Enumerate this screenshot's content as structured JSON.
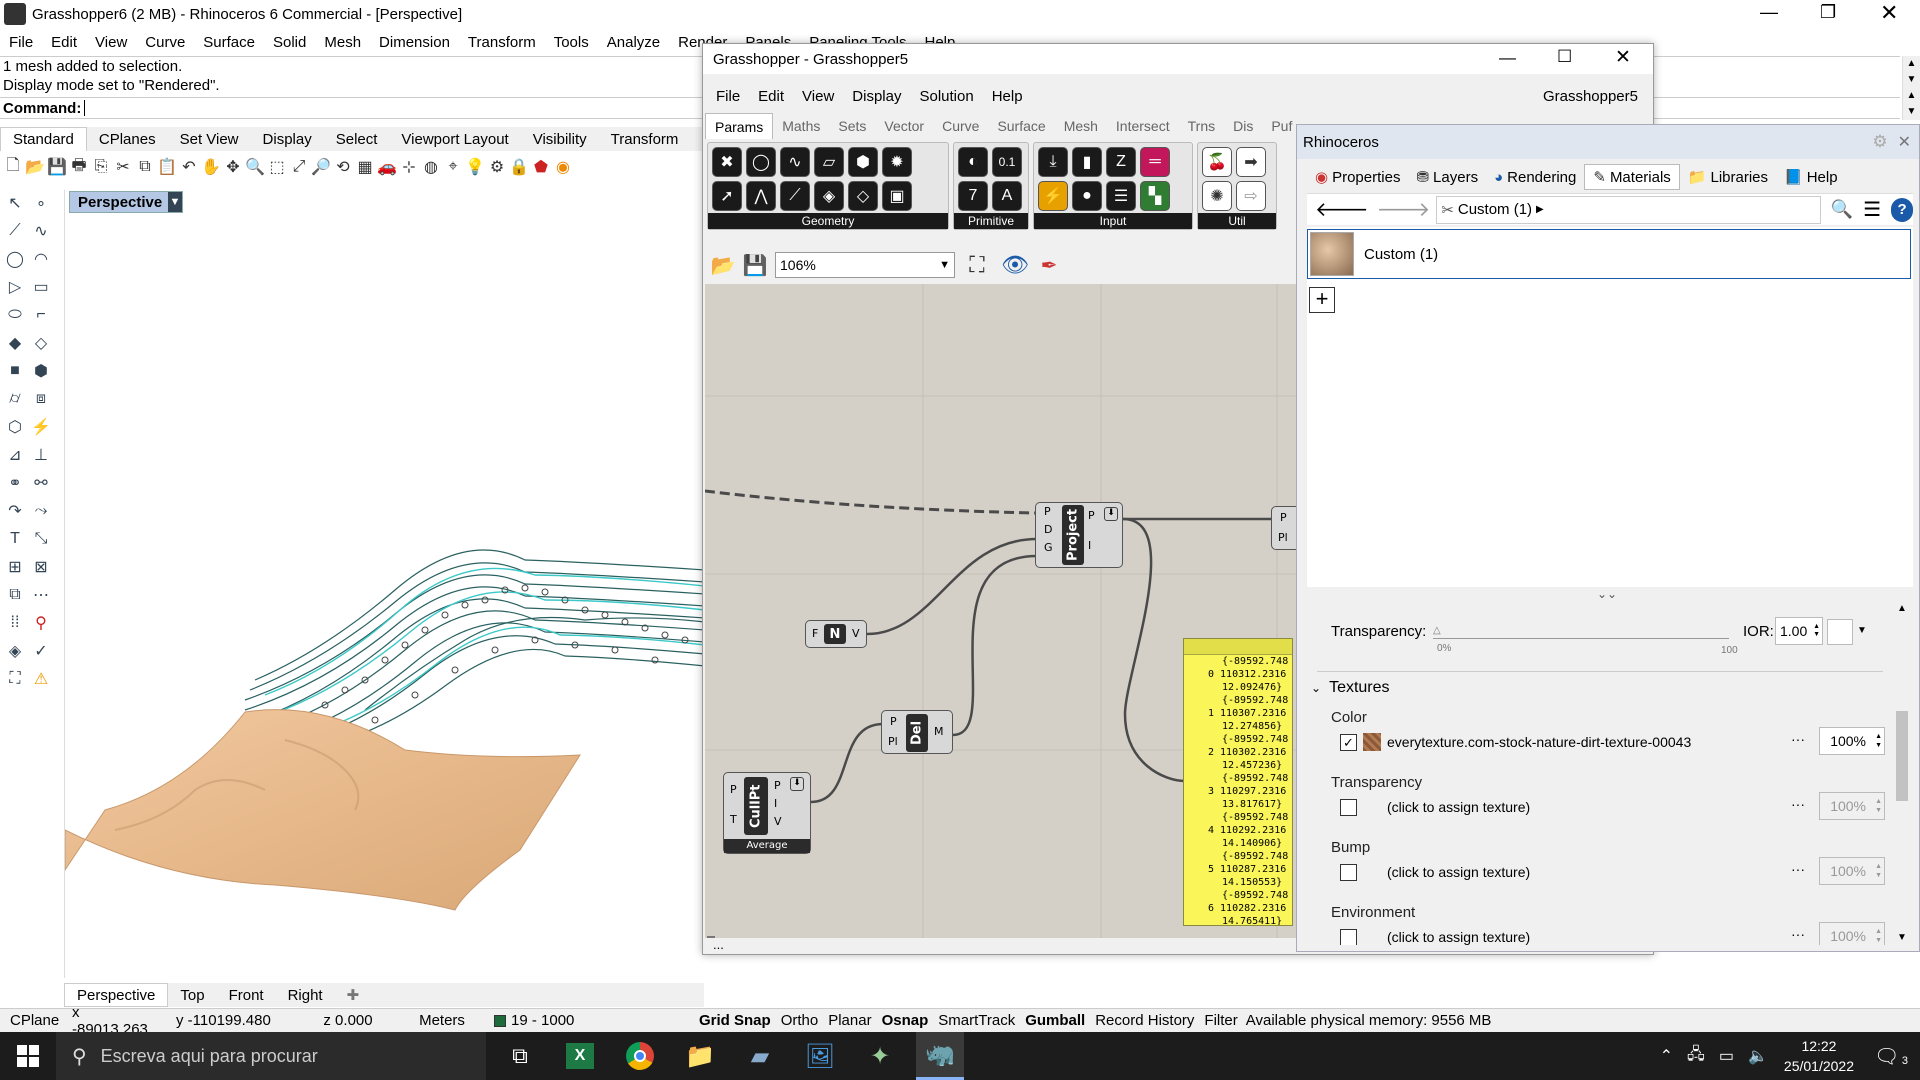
{
  "rhino": {
    "title": "Grasshopper6 (2 MB) - Rhinoceros 6 Commercial - [Perspective]",
    "menu": [
      "File",
      "Edit",
      "View",
      "Curve",
      "Surface",
      "Solid",
      "Mesh",
      "Dimension",
      "Transform",
      "Tools",
      "Analyze",
      "Render",
      "Panels",
      "Paneling Tools",
      "Help"
    ],
    "history": [
      "1 mesh added to selection.",
      "Display mode set to \"Rendered\"."
    ],
    "command_label": "Command:",
    "toolbar_tabs": [
      "Standard",
      "CPlanes",
      "Set View",
      "Display",
      "Select",
      "Viewport Layout",
      "Visibility",
      "Transform"
    ],
    "viewport_label": "Perspective",
    "view_tabs": [
      "Perspective",
      "Top",
      "Front",
      "Right"
    ],
    "status": {
      "cplane": "CPlane",
      "x": "x -89013.263",
      "y": "y -110199.480",
      "z": "z 0.000",
      "units": "Meters",
      "layer": "19 - 1000",
      "toggles": [
        "Grid Snap",
        "Ortho",
        "Planar",
        "Osnap",
        "SmartTrack",
        "Gumball",
        "Record History",
        "Filter"
      ],
      "memory": "Available physical memory: 9556 MB"
    }
  },
  "gh": {
    "title": "Grasshopper - Grasshopper5",
    "menu": [
      "File",
      "Edit",
      "View",
      "Display",
      "Solution",
      "Help"
    ],
    "doc_name": "Grasshopper5",
    "tabs": [
      "Params",
      "Maths",
      "Sets",
      "Vector",
      "Curve",
      "Surface",
      "Mesh",
      "Intersect",
      "Trns",
      "Dis",
      "Puf"
    ],
    "groups": [
      "Geometry",
      "Primitive",
      "Input",
      "Util"
    ],
    "zoom": "106%",
    "status": "...",
    "components": {
      "project": {
        "name": "Project",
        "inputs": [
          "P",
          "D",
          "G"
        ],
        "outputs": [
          "P",
          "I"
        ]
      },
      "unit": {
        "name": "N",
        "inputs": [
          "F"
        ],
        "outputs": [
          "V"
        ]
      },
      "del": {
        "name": "Del",
        "inputs": [
          "P",
          "Pl"
        ],
        "outputs": [
          "M"
        ]
      },
      "cullpt": {
        "name": "CullPt",
        "inputs": [
          "P",
          "T"
        ],
        "outputs": [
          "P",
          "I",
          "V"
        ],
        "tag": "Average"
      },
      "right": {
        "inputs": [
          "P",
          "Pl"
        ]
      }
    },
    "panel_lines": [
      "{-89592.748",
      "0 110312.2316",
      "12.092476}",
      "{-89592.748",
      "1 110307.2316",
      "12.274856}",
      "{-89592.748",
      "2 110302.2316",
      "12.457236}",
      "{-89592.748",
      "3 110297.2316",
      "13.817617}",
      "{-89592.748",
      "4 110292.2316",
      "14.140906}",
      "{-89592.748",
      "5 110287.2316",
      "14.150553}",
      "{-89592.748",
      "6 110282.2316",
      "14.765411}"
    ]
  },
  "rp": {
    "title": "Rhinoceros",
    "tabs": [
      "Properties",
      "Layers",
      "Rendering",
      "Materials",
      "Libraries",
      "Help"
    ],
    "breadcrumb": "Custom (1)",
    "material_name": "Custom (1)",
    "transparency_label": "Transparency:",
    "transparency_min": "0%",
    "transparency_max": "100",
    "ior_label": "IOR:",
    "ior_value": "1.00",
    "textures_header": "Textures",
    "textures": [
      {
        "label": "Color",
        "checked": true,
        "name": "everytexture.com-stock-nature-dirt-texture-00043",
        "amount": "100%"
      },
      {
        "label": "Transparency",
        "checked": false,
        "name": "(click to assign texture)",
        "amount": "100%"
      },
      {
        "label": "Bump",
        "checked": false,
        "name": "(click to assign texture)",
        "amount": "100%"
      },
      {
        "label": "Environment",
        "checked": false,
        "name": "(click to assign texture)",
        "amount": "100%"
      }
    ]
  },
  "taskbar": {
    "search_placeholder": "Escreva aqui para procurar",
    "time": "12:22",
    "date": "25/01/2022",
    "notif_count": "3"
  },
  "colors": {
    "gh_canvas": "#d4d0c8",
    "panel_yellow": "#faf65a",
    "wire_cyan": "#3cc8c8",
    "terrain": "#e6b88a",
    "taskbar": "#1c1c1c"
  }
}
